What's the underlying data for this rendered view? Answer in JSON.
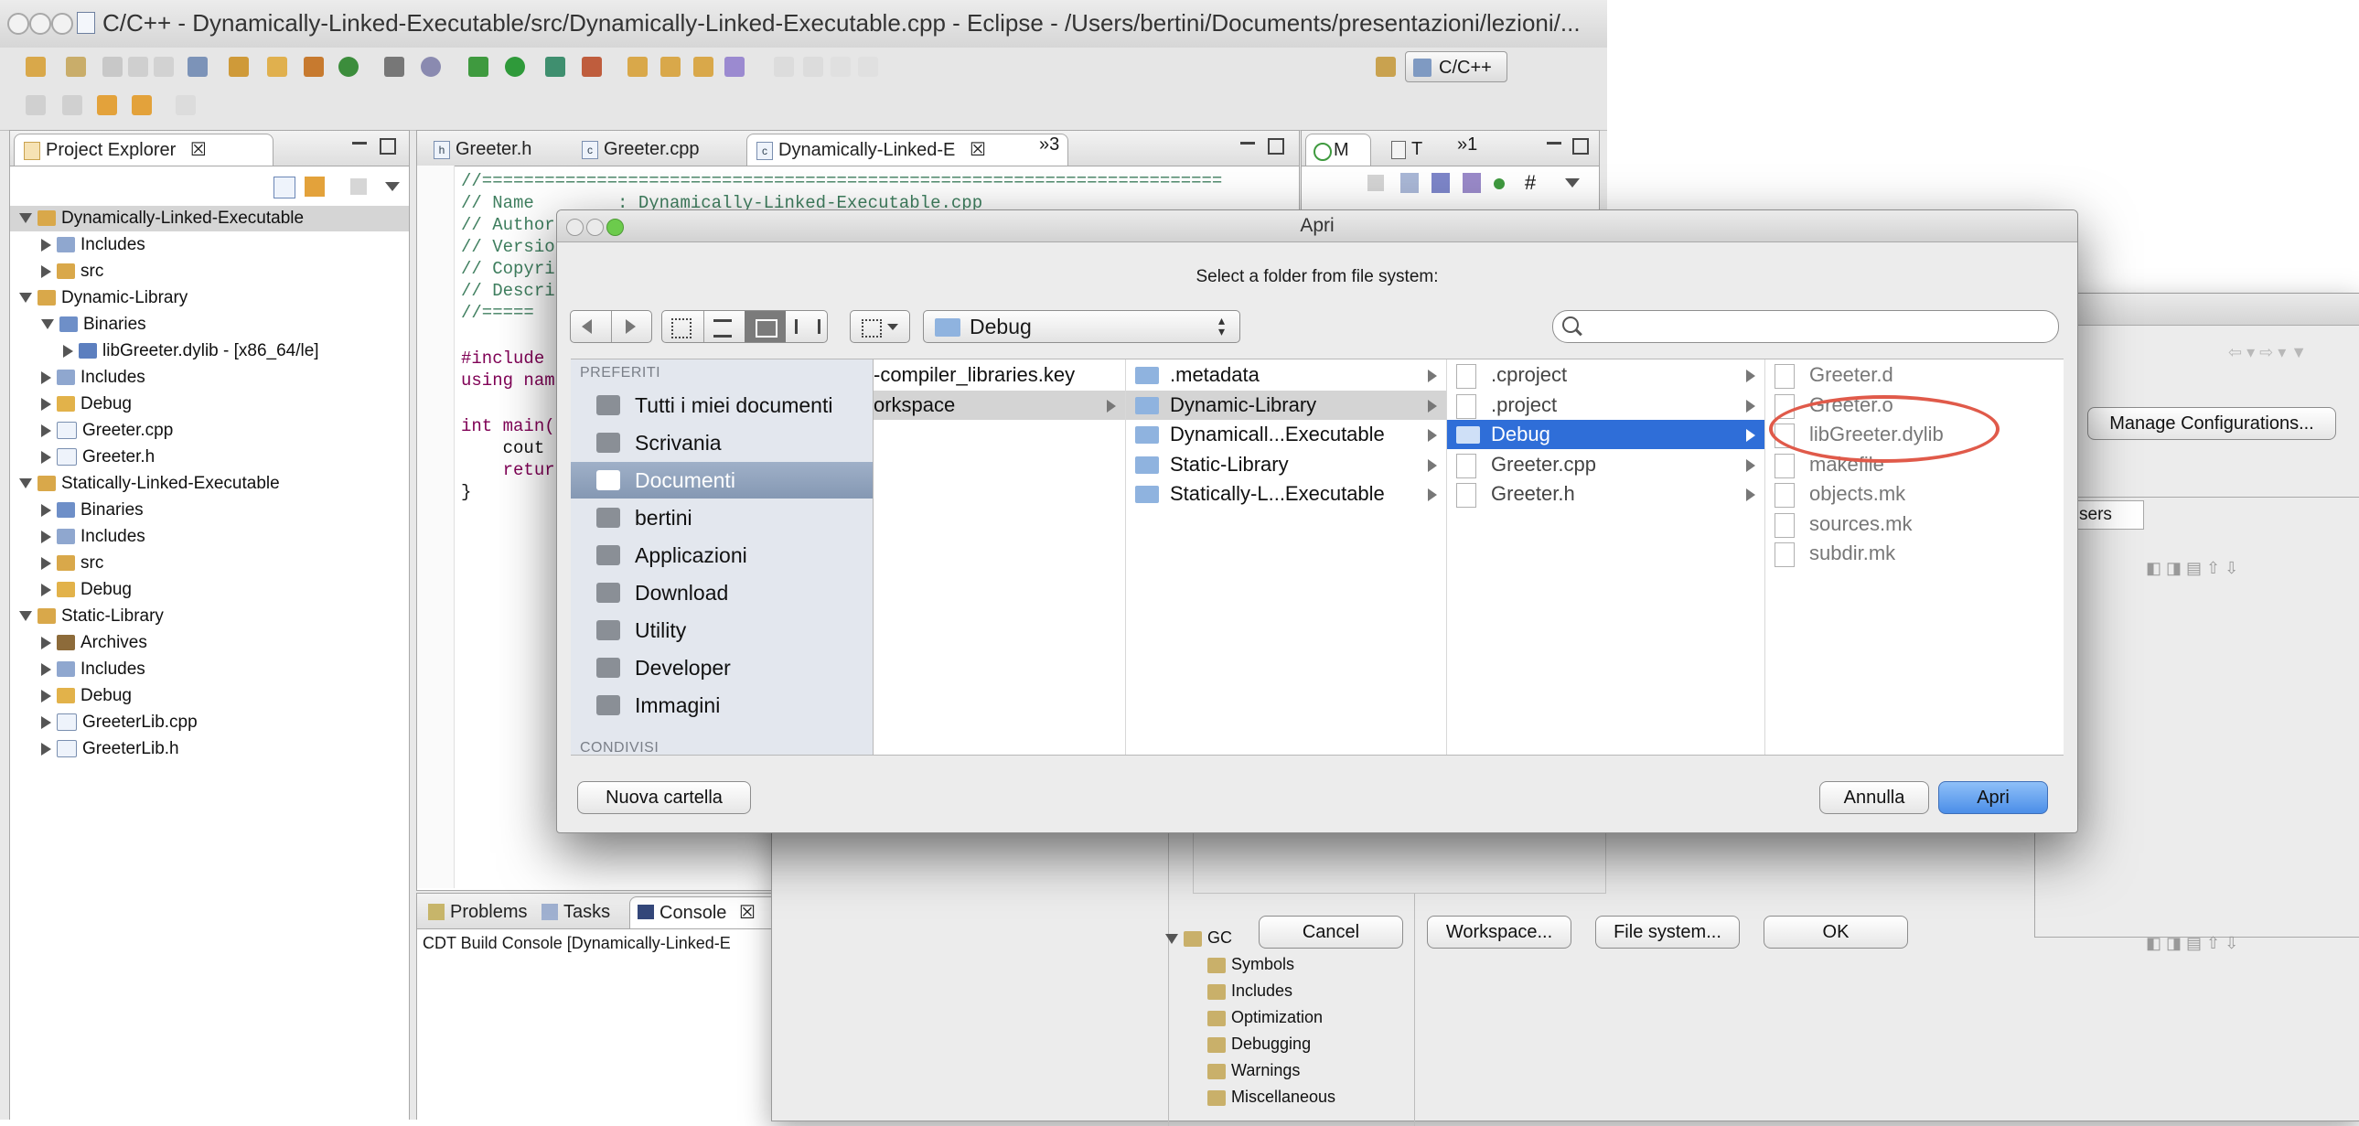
{
  "eclipse": {
    "title": "C/C++ - Dynamically-Linked-Executable/src/Dynamically-Linked-Executable.cpp - Eclipse - /Users/bertini/Documents/presentazioni/lezioni/...",
    "perspective_label": "C/C++",
    "project_explorer": {
      "tab_label": "Project Explorer",
      "tab_close": "☒",
      "tree": [
        {
          "label": "Dynamically-Linked-Executable",
          "depth": 0,
          "expanded": true,
          "kind": "project",
          "selected": true
        },
        {
          "label": "Includes",
          "depth": 1,
          "kind": "includes"
        },
        {
          "label": "src",
          "depth": 1,
          "kind": "src"
        },
        {
          "label": "Dynamic-Library",
          "depth": 0,
          "expanded": true,
          "kind": "project"
        },
        {
          "label": "Binaries",
          "depth": 1,
          "expanded": true,
          "kind": "binaries"
        },
        {
          "label": "libGreeter.dylib - [x86_64/le]",
          "depth": 2,
          "kind": "lib"
        },
        {
          "label": "Includes",
          "depth": 1,
          "kind": "includes"
        },
        {
          "label": "Debug",
          "depth": 1,
          "kind": "folder"
        },
        {
          "label": "Greeter.cpp",
          "depth": 1,
          "kind": "cpp"
        },
        {
          "label": "Greeter.h",
          "depth": 1,
          "kind": "h"
        },
        {
          "label": "Statically-Linked-Executable",
          "depth": 0,
          "expanded": true,
          "kind": "project"
        },
        {
          "label": "Binaries",
          "depth": 1,
          "kind": "binaries"
        },
        {
          "label": "Includes",
          "depth": 1,
          "kind": "includes"
        },
        {
          "label": "src",
          "depth": 1,
          "kind": "src"
        },
        {
          "label": "Debug",
          "depth": 1,
          "kind": "folder"
        },
        {
          "label": "Static-Library",
          "depth": 0,
          "expanded": true,
          "kind": "project"
        },
        {
          "label": "Archives",
          "depth": 1,
          "kind": "archives"
        },
        {
          "label": "Includes",
          "depth": 1,
          "kind": "includes"
        },
        {
          "label": "Debug",
          "depth": 1,
          "kind": "folder"
        },
        {
          "label": "GreeterLib.cpp",
          "depth": 1,
          "kind": "cpp"
        },
        {
          "label": "GreeterLib.h",
          "depth": 1,
          "kind": "h"
        }
      ]
    },
    "editor": {
      "tabs": [
        {
          "label": "Greeter.h",
          "icon": "h"
        },
        {
          "label": "Greeter.cpp",
          "icon": "c"
        },
        {
          "label": "Dynamically-Linked-E",
          "icon": "c",
          "active": true
        }
      ],
      "active_tab_close": "☒",
      "overflow_label": "»3",
      "code": {
        "rule": "//=======================================================================",
        "name": "// Name        : Dynamically-Linked-Executable.cpp",
        "author": "// Author",
        "version": "// Versio",
        "copyright": "// Copyri",
        "description": "// Descri",
        "rule2": "//=====",
        "include": "#include",
        "using": "using nam",
        "main": "int main(",
        "cout": "    cout",
        "ret": "    retur",
        "brace": "}"
      }
    },
    "outline": {
      "tabs": [
        {
          "label": "M",
          "icon": "outline"
        },
        {
          "label": "T",
          "icon": "task"
        }
      ],
      "overflow_label": "»1"
    },
    "bottom": {
      "tabs": [
        {
          "label": "Problems"
        },
        {
          "label": "Tasks"
        },
        {
          "label": "Console",
          "active": true
        }
      ],
      "console_close": "☒",
      "console_line": "CDT Build Console [Dynamically-Linked-E"
    }
  },
  "back_dialog": {
    "manage_button": "Manage Configurations...",
    "tab_label": "sers",
    "tree": [
      {
        "label": "GC",
        "expanded": true
      },
      {
        "label": "Symbols"
      },
      {
        "label": "Includes"
      },
      {
        "label": "Optimization"
      },
      {
        "label": "Debugging"
      },
      {
        "label": "Warnings"
      },
      {
        "label": "Miscellaneous"
      }
    ],
    "buttons": {
      "cancel": "Cancel",
      "workspace": "Workspace...",
      "file_system": "File system...",
      "ok": "OK"
    }
  },
  "open_dialog": {
    "title": "Apri",
    "prompt": "Select a folder from file system:",
    "location": "Debug",
    "search": {
      "placeholder": "",
      "value": ""
    },
    "sidebar": {
      "header": "PREFERITI",
      "footer_header": "CONDIVISI",
      "items": [
        {
          "label": "Tutti i miei documenti",
          "icon": "documents-stack-icon"
        },
        {
          "label": "Scrivania",
          "icon": "desktop-icon"
        },
        {
          "label": "Documenti",
          "icon": "documents-folder-icon",
          "selected": true
        },
        {
          "label": "bertini",
          "icon": "home-icon"
        },
        {
          "label": "Applicazioni",
          "icon": "applications-icon"
        },
        {
          "label": "Download",
          "icon": "download-icon"
        },
        {
          "label": "Utility",
          "icon": "utility-icon"
        },
        {
          "label": "Developer",
          "icon": "folder-icon"
        },
        {
          "label": "Immagini",
          "icon": "camera-icon"
        }
      ]
    },
    "columns": [
      {
        "items": [
          {
            "label": "-compiler_libraries.key",
            "kind": "none"
          },
          {
            "label": "orkspace",
            "kind": "none",
            "arrow": true,
            "highlight": true
          }
        ]
      },
      {
        "items": [
          {
            "label": ".metadata",
            "kind": "folder",
            "arrow": true
          },
          {
            "label": "Dynamic-Library",
            "kind": "folder",
            "arrow": true,
            "highlight": true
          },
          {
            "label": "Dynamicall...Executable",
            "kind": "folder",
            "arrow": true
          },
          {
            "label": "Static-Library",
            "kind": "folder",
            "arrow": true
          },
          {
            "label": "Statically-L...Executable",
            "kind": "folder",
            "arrow": true
          }
        ]
      },
      {
        "items": [
          {
            "label": ".cproject",
            "kind": "doc",
            "arrow": true,
            "gray": true
          },
          {
            "label": ".project",
            "kind": "doc",
            "arrow": true,
            "gray": true
          },
          {
            "label": "Debug",
            "kind": "folder",
            "arrow": true,
            "selected": true
          },
          {
            "label": "Greeter.cpp",
            "kind": "doc",
            "arrow": true,
            "gray": true
          },
          {
            "label": "Greeter.h",
            "kind": "doc",
            "arrow": true,
            "gray": true
          }
        ]
      },
      {
        "items": [
          {
            "label": "Greeter.d",
            "kind": "doc",
            "gray": true
          },
          {
            "label": "Greeter.o",
            "kind": "doc",
            "gray": true
          },
          {
            "label": "libGreeter.dylib",
            "kind": "doc",
            "gray": true,
            "circled": true
          },
          {
            "label": "makefile",
            "kind": "doc",
            "gray": true
          },
          {
            "label": "objects.mk",
            "kind": "doc",
            "gray": true
          },
          {
            "label": "sources.mk",
            "kind": "doc",
            "gray": true
          },
          {
            "label": "subdir.mk",
            "kind": "doc",
            "gray": true
          }
        ]
      }
    ],
    "buttons": {
      "new_folder": "Nuova cartella",
      "cancel": "Annulla",
      "open": "Apri"
    }
  },
  "colors": {
    "selection_blue": "#2f6ed8",
    "annotation_red": "#e05a4a",
    "sidebar_bg": "#e3e7ee",
    "default_button": "#5b9cf0"
  }
}
